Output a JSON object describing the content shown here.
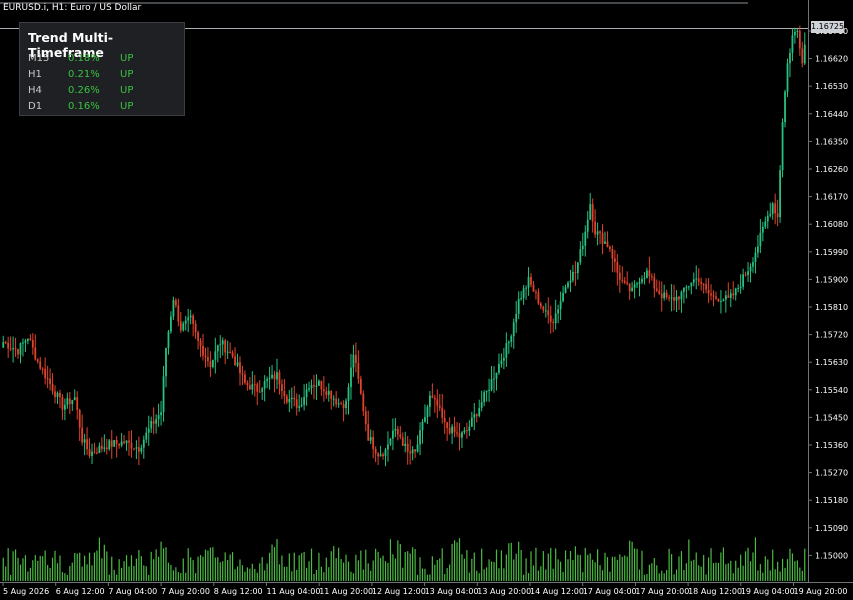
{
  "window": {
    "title": "EURUSD.i, H1:  Euro / US Dollar"
  },
  "trend_panel": {
    "title": "Trend Multi-Timeframe",
    "rows": [
      {
        "timeframe": "M15",
        "percent": "0.18%",
        "direction": "UP"
      },
      {
        "timeframe": "H1",
        "percent": "0.21%",
        "direction": "UP"
      },
      {
        "timeframe": "H4",
        "percent": "0.26%",
        "direction": "UP"
      },
      {
        "timeframe": "D1",
        "percent": "0.16%",
        "direction": "UP"
      }
    ]
  },
  "current_price": "1.16725",
  "colors": {
    "background": "#000000",
    "bull": "#26c281",
    "bear": "#e0442b",
    "volume": "#4cbb44",
    "axis_text": "#ffffff",
    "price_line": "#a7adb3",
    "panel_bg": "#1e2024",
    "trend_up": "#38c43e"
  },
  "price_axis": {
    "labels": [
      "1.16725",
      "1.16710",
      "1.16620",
      "1.16530",
      "1.16440",
      "1.16350",
      "1.16260",
      "1.16170",
      "1.16080",
      "1.15990",
      "1.15900",
      "1.15810",
      "1.15720",
      "1.15630",
      "1.15540",
      "1.15450",
      "1.15360",
      "1.15270",
      "1.15180",
      "1.15090",
      "1.15000"
    ]
  },
  "time_axis": {
    "labels": [
      "5 Aug 2026",
      "6 Aug 12:00",
      "7 Aug 04:00",
      "7 Aug 20:00",
      "8 Aug 12:00",
      "11 Aug 04:00",
      "11 Aug 20:00",
      "12 Aug 12:00",
      "13 Aug 04:00",
      "13 Aug 20:00",
      "14 Aug 12:00",
      "17 Aug 04:00",
      "17 Aug 20:00",
      "18 Aug 12:00",
      "19 Aug 04:00",
      "19 Aug 20:00"
    ]
  },
  "chart_data": {
    "type": "candlestick",
    "symbol": "EURUSD.i",
    "timeframe": "H1",
    "ylim": [
      1.1496,
      1.1678
    ],
    "anchors": [
      [
        0,
        1.156
      ],
      [
        6,
        1.1557
      ],
      [
        10,
        1.1562
      ],
      [
        14,
        1.1553
      ],
      [
        19,
        1.1545
      ],
      [
        24,
        1.1537
      ],
      [
        29,
        1.154
      ],
      [
        32,
        1.1525
      ],
      [
        35,
        1.152
      ],
      [
        42,
        1.1523
      ],
      [
        49,
        1.1524
      ],
      [
        55,
        1.1522
      ],
      [
        60,
        1.153
      ],
      [
        64,
        1.1535
      ],
      [
        66,
        1.1558
      ],
      [
        69,
        1.1576
      ],
      [
        72,
        1.1565
      ],
      [
        76,
        1.1568
      ],
      [
        79,
        1.156
      ],
      [
        84,
        1.1552
      ],
      [
        88,
        1.156
      ],
      [
        93,
        1.1555
      ],
      [
        98,
        1.1545
      ],
      [
        103,
        1.1543
      ],
      [
        107,
        1.1546
      ],
      [
        111,
        1.1548
      ],
      [
        115,
        1.154
      ],
      [
        120,
        1.1537
      ],
      [
        124,
        1.1545
      ],
      [
        128,
        1.1545
      ],
      [
        132,
        1.1542
      ],
      [
        136,
        1.1538
      ],
      [
        139,
        1.1538
      ],
      [
        142,
        1.1556
      ],
      [
        145,
        1.1541
      ],
      [
        148,
        1.1526
      ],
      [
        152,
        1.152
      ],
      [
        155,
        1.1521
      ],
      [
        158,
        1.1528
      ],
      [
        161,
        1.1526
      ],
      [
        164,
        1.152
      ],
      [
        167,
        1.152
      ],
      [
        170,
        1.153
      ],
      [
        173,
        1.154
      ],
      [
        176,
        1.1537
      ],
      [
        179,
        1.153
      ],
      [
        182,
        1.1528
      ],
      [
        185,
        1.1526
      ],
      [
        188,
        1.1528
      ],
      [
        192,
        1.1535
      ],
      [
        196,
        1.1542
      ],
      [
        200,
        1.155
      ],
      [
        205,
        1.156
      ],
      [
        209,
        1.1575
      ],
      [
        213,
        1.1582
      ],
      [
        217,
        1.1575
      ],
      [
        220,
        1.157
      ],
      [
        223,
        1.1568
      ],
      [
        226,
        1.1575
      ],
      [
        229,
        1.1583
      ],
      [
        232,
        1.1585
      ],
      [
        234,
        1.1592
      ],
      [
        236,
        1.16
      ],
      [
        238,
        1.161
      ],
      [
        240,
        1.16
      ],
      [
        243,
        1.1597
      ],
      [
        246,
        1.1594
      ],
      [
        249,
        1.1585
      ],
      [
        252,
        1.158
      ],
      [
        255,
        1.1578
      ],
      [
        258,
        1.1583
      ],
      [
        261,
        1.1585
      ],
      [
        264,
        1.158
      ],
      [
        267,
        1.1577
      ],
      [
        270,
        1.1575
      ],
      [
        273,
        1.1576
      ],
      [
        276,
        1.1578
      ],
      [
        279,
        1.1582
      ],
      [
        282,
        1.1583
      ],
      [
        285,
        1.1578
      ],
      [
        288,
        1.1576
      ],
      [
        291,
        1.1576
      ],
      [
        294,
        1.1575
      ],
      [
        297,
        1.1578
      ],
      [
        300,
        1.1583
      ],
      [
        303,
        1.1588
      ],
      [
        306,
        1.1595
      ],
      [
        309,
        1.1603
      ],
      [
        312,
        1.161
      ],
      [
        314,
        1.1605
      ],
      [
        316,
        1.164
      ],
      [
        318,
        1.166
      ],
      [
        320,
        1.167
      ],
      [
        322,
        1.1672
      ],
      [
        324,
        1.1662
      ],
      [
        325,
        1.1667
      ]
    ]
  }
}
